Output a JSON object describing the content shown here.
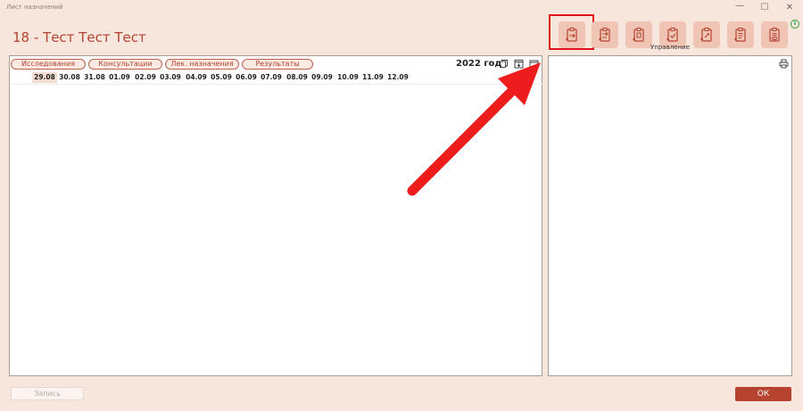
{
  "window": {
    "title": "Лист назначений",
    "minimize_glyph": "—",
    "maximize_glyph": "☐",
    "close_glyph": "✕"
  },
  "patient": {
    "title": "18 - Тест Тест Тест"
  },
  "toolbar": {
    "label": "Управление",
    "info_glyph": "i",
    "buttons": [
      {
        "icon": "clipboard-arrow-in-icon"
      },
      {
        "icon": "clipboard-arrow-out-icon"
      },
      {
        "icon": "clipboard-plus-icon"
      },
      {
        "icon": "clipboard-check-icon"
      },
      {
        "icon": "clipboard-edit-icon"
      },
      {
        "icon": "clipboard-list-icon"
      },
      {
        "icon": "clipboard-view-icon"
      }
    ]
  },
  "left": {
    "tabs": [
      "Исследования",
      "Консультации",
      "Лек. назначения",
      "Результаты"
    ],
    "year": "2022 год",
    "dates": [
      "29.08",
      "30.08",
      "31.08",
      "01.09",
      "02.09",
      "03.09",
      "04.09",
      "05.09",
      "06.09",
      "07.09",
      "08.09",
      "09.09",
      "10.09",
      "11.09",
      "12.09"
    ],
    "active_date": "29.08"
  },
  "footer": {
    "save_label": "Запись",
    "ok_label": "ОК"
  },
  "colors": {
    "accent": "#b5432f",
    "background": "#f7e6dc",
    "highlight": "#e0141a",
    "info": "#2e9e3a"
  }
}
